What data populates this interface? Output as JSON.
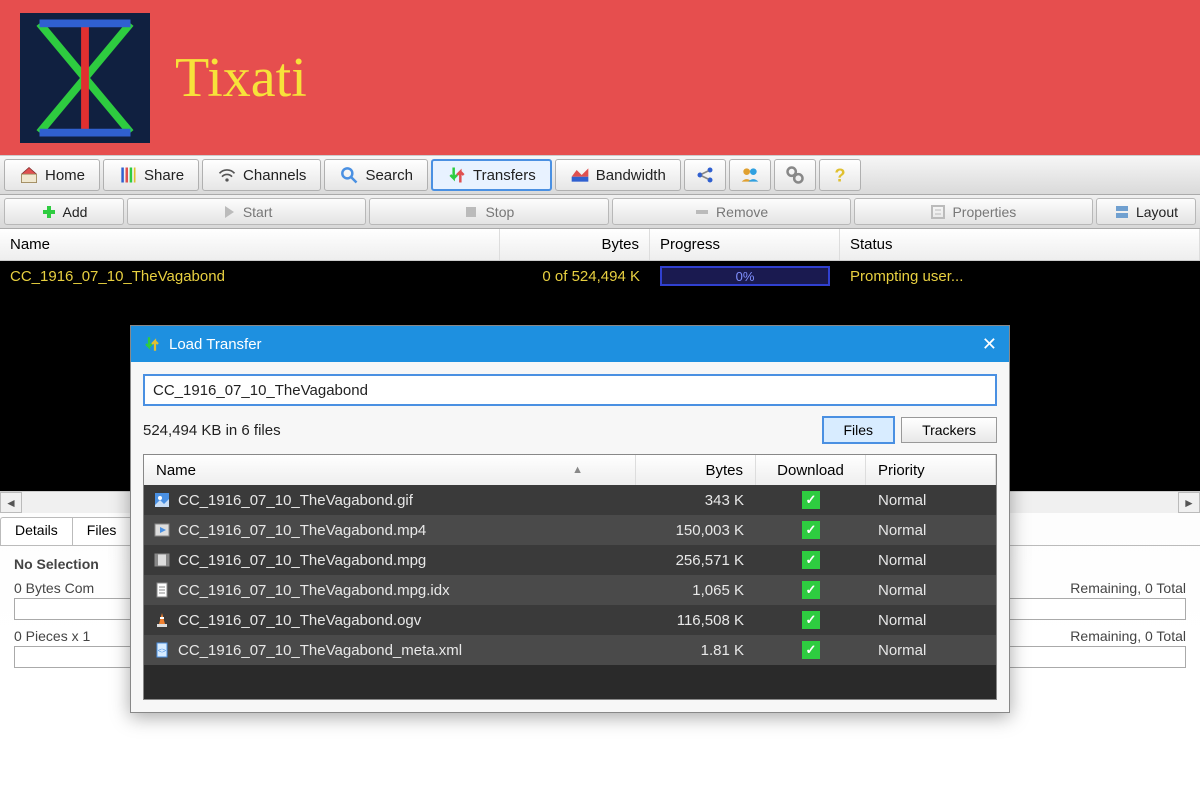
{
  "banner": {
    "title": "Tixati"
  },
  "toolbar": {
    "home": "Home",
    "share": "Share",
    "channels": "Channels",
    "search": "Search",
    "transfers": "Transfers",
    "bandwidth": "Bandwidth"
  },
  "actions": {
    "add": "Add",
    "start": "Start",
    "stop": "Stop",
    "remove": "Remove",
    "properties": "Properties",
    "layout": "Layout"
  },
  "columns": {
    "name": "Name",
    "bytes": "Bytes",
    "progress": "Progress",
    "status": "Status"
  },
  "transfer": {
    "name": "CC_1916_07_10_TheVagabond",
    "bytes": "0 of 524,494 K",
    "progress": "0%",
    "status": "Prompting user..."
  },
  "bottom": {
    "tab_details": "Details",
    "tab_files": "Files",
    "no_selection": "No Selection",
    "bytes_line_left": "0 Bytes Com",
    "bytes_line_right": "Remaining,  0 Total",
    "pieces_line_left": "0 Pieces  x  1",
    "pieces_line_right": "Remaining,  0 Total"
  },
  "dialog": {
    "title": "Load Transfer",
    "input_value": "CC_1916_07_10_TheVagabond",
    "info": "524,494 KB in 6 files",
    "tab_files": "Files",
    "tab_trackers": "Trackers",
    "cols": {
      "name": "Name",
      "bytes": "Bytes",
      "download": "Download",
      "priority": "Priority"
    },
    "files": [
      {
        "icon": "img",
        "name": "CC_1916_07_10_TheVagabond.gif",
        "bytes": "343 K",
        "priority": "Normal"
      },
      {
        "icon": "vid",
        "name": "CC_1916_07_10_TheVagabond.mp4",
        "bytes": "150,003 K",
        "priority": "Normal"
      },
      {
        "icon": "vid2",
        "name": "CC_1916_07_10_TheVagabond.mpg",
        "bytes": "256,571 K",
        "priority": "Normal"
      },
      {
        "icon": "doc",
        "name": "CC_1916_07_10_TheVagabond.mpg.idx",
        "bytes": "1,065 K",
        "priority": "Normal"
      },
      {
        "icon": "vlc",
        "name": "CC_1916_07_10_TheVagabond.ogv",
        "bytes": "116,508 K",
        "priority": "Normal"
      },
      {
        "icon": "xml",
        "name": "CC_1916_07_10_TheVagabond_meta.xml",
        "bytes": "1.81 K",
        "priority": "Normal"
      }
    ]
  }
}
